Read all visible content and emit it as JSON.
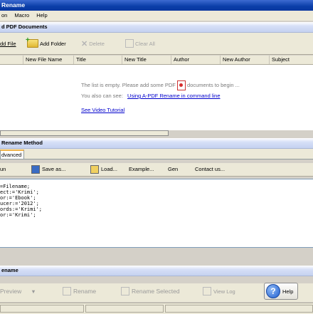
{
  "window": {
    "title": "Rename"
  },
  "menu": {
    "items": [
      "on",
      "Macro",
      "Help"
    ]
  },
  "documents": {
    "title": "d PDF Documents",
    "toolbar": {
      "add_file": "dd File",
      "add_folder": "Add Folder",
      "delete": "Delete",
      "clear_all": "Clear All"
    },
    "columns": [
      "New File Name",
      "Title",
      "New Title",
      "Author",
      "New Author",
      "Subject"
    ],
    "empty_message_1": "The list is empty. Please add some PDF",
    "empty_message_2": "documents to begin ...",
    "also_text": "You also can see:",
    "command_line_link": "Using A-PDF Rename  in command line",
    "video_link": "See Video Tutorial"
  },
  "method": {
    "title": "Rename Method",
    "tab_label": "dvanced",
    "toolbar": {
      "run": "un",
      "save_as": "Save as...",
      "load": "Load...",
      "example": "Example...",
      "gen": "Gen",
      "contact": "Contact us..."
    },
    "script_lines": [
      "=Filename;",
      "ect:='Krimi';",
      "or:='Ebook';",
      "ucer:='2012';",
      "ords:='Krimi';",
      "or:='Krimi';"
    ]
  },
  "rename_section": {
    "title": "ename",
    "preview": "Preview",
    "rename": "Rename",
    "rename_selected": "Rename Selected",
    "view_log": "View Log",
    "help": "Help"
  }
}
